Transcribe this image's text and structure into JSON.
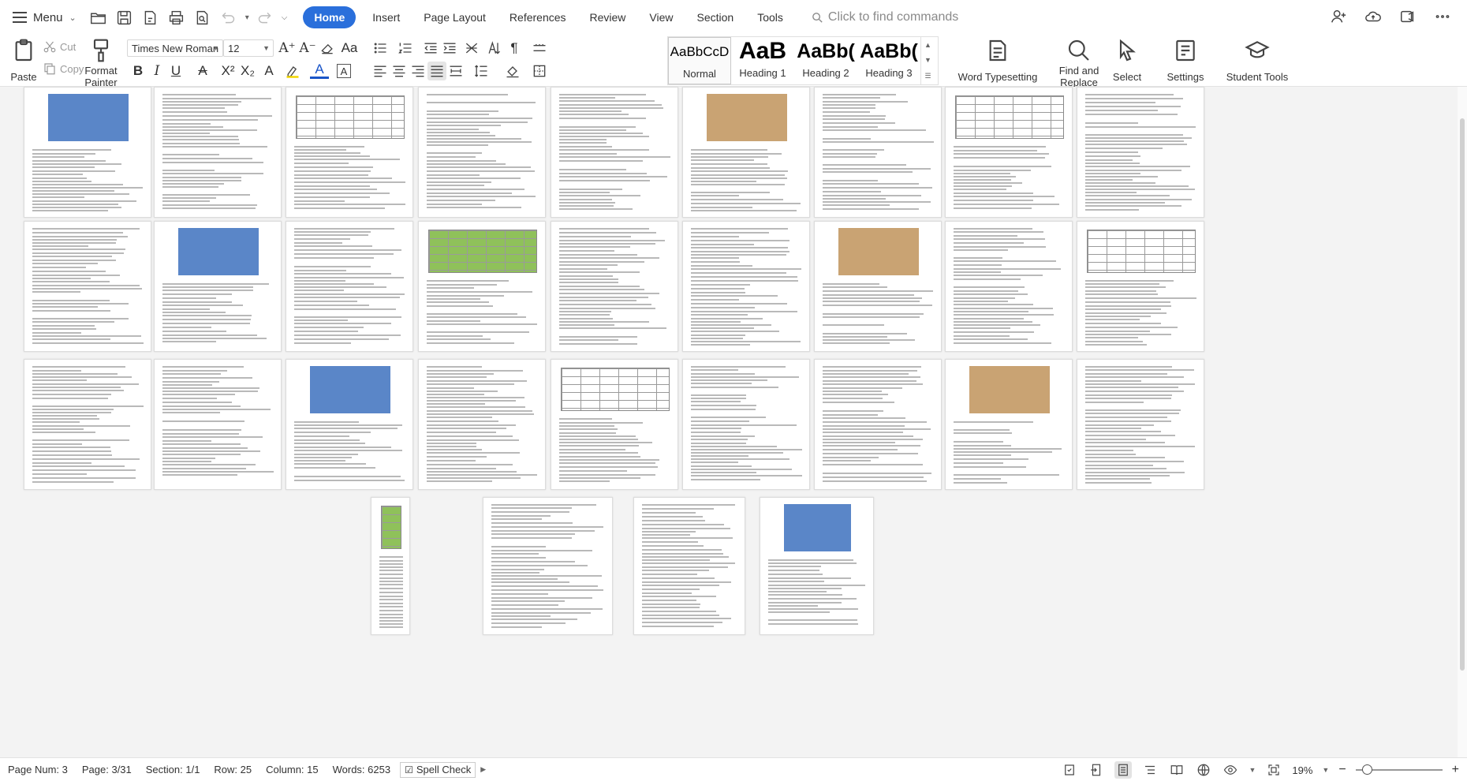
{
  "menubar": {
    "menu_label": "Menu",
    "tabs": [
      {
        "label": "Home",
        "active": true
      },
      {
        "label": "Insert"
      },
      {
        "label": "Page Layout"
      },
      {
        "label": "References"
      },
      {
        "label": "Review"
      },
      {
        "label": "View"
      },
      {
        "label": "Section"
      },
      {
        "label": "Tools"
      }
    ],
    "search_placeholder": "Click to find commands"
  },
  "ribbon": {
    "paste": "Paste",
    "cut": "Cut",
    "copy": "Copy",
    "format_painter_1": "Format",
    "format_painter_2": "Painter",
    "font_name": "Times New Roman",
    "font_size": "12",
    "styles": [
      {
        "preview": "AaBbCcD",
        "name": "Normal"
      },
      {
        "preview": "AaB",
        "name": "Heading 1"
      },
      {
        "preview": "AaBb(",
        "name": "Heading 2"
      },
      {
        "preview": "AaBb(",
        "name": "Heading 3"
      }
    ],
    "word_typesetting": "Word Typesetting",
    "find_replace_1": "Find and",
    "find_replace_2": "Replace",
    "select": "Select",
    "settings": "Settings",
    "student_tools": "Student Tools"
  },
  "statusbar": {
    "page_num": "Page Num: 3",
    "page": "Page: 3/31",
    "section": "Section: 1/1",
    "row": "Row: 25",
    "column": "Column: 15",
    "words": "Words: 6253",
    "spell_check": "Spell Check",
    "zoom": "19%"
  },
  "colors": {
    "accent": "#2a6fdb",
    "table_green": "#8fc15a",
    "photo_blue": "#5a86c8",
    "photo_tan": "#c9a373"
  }
}
